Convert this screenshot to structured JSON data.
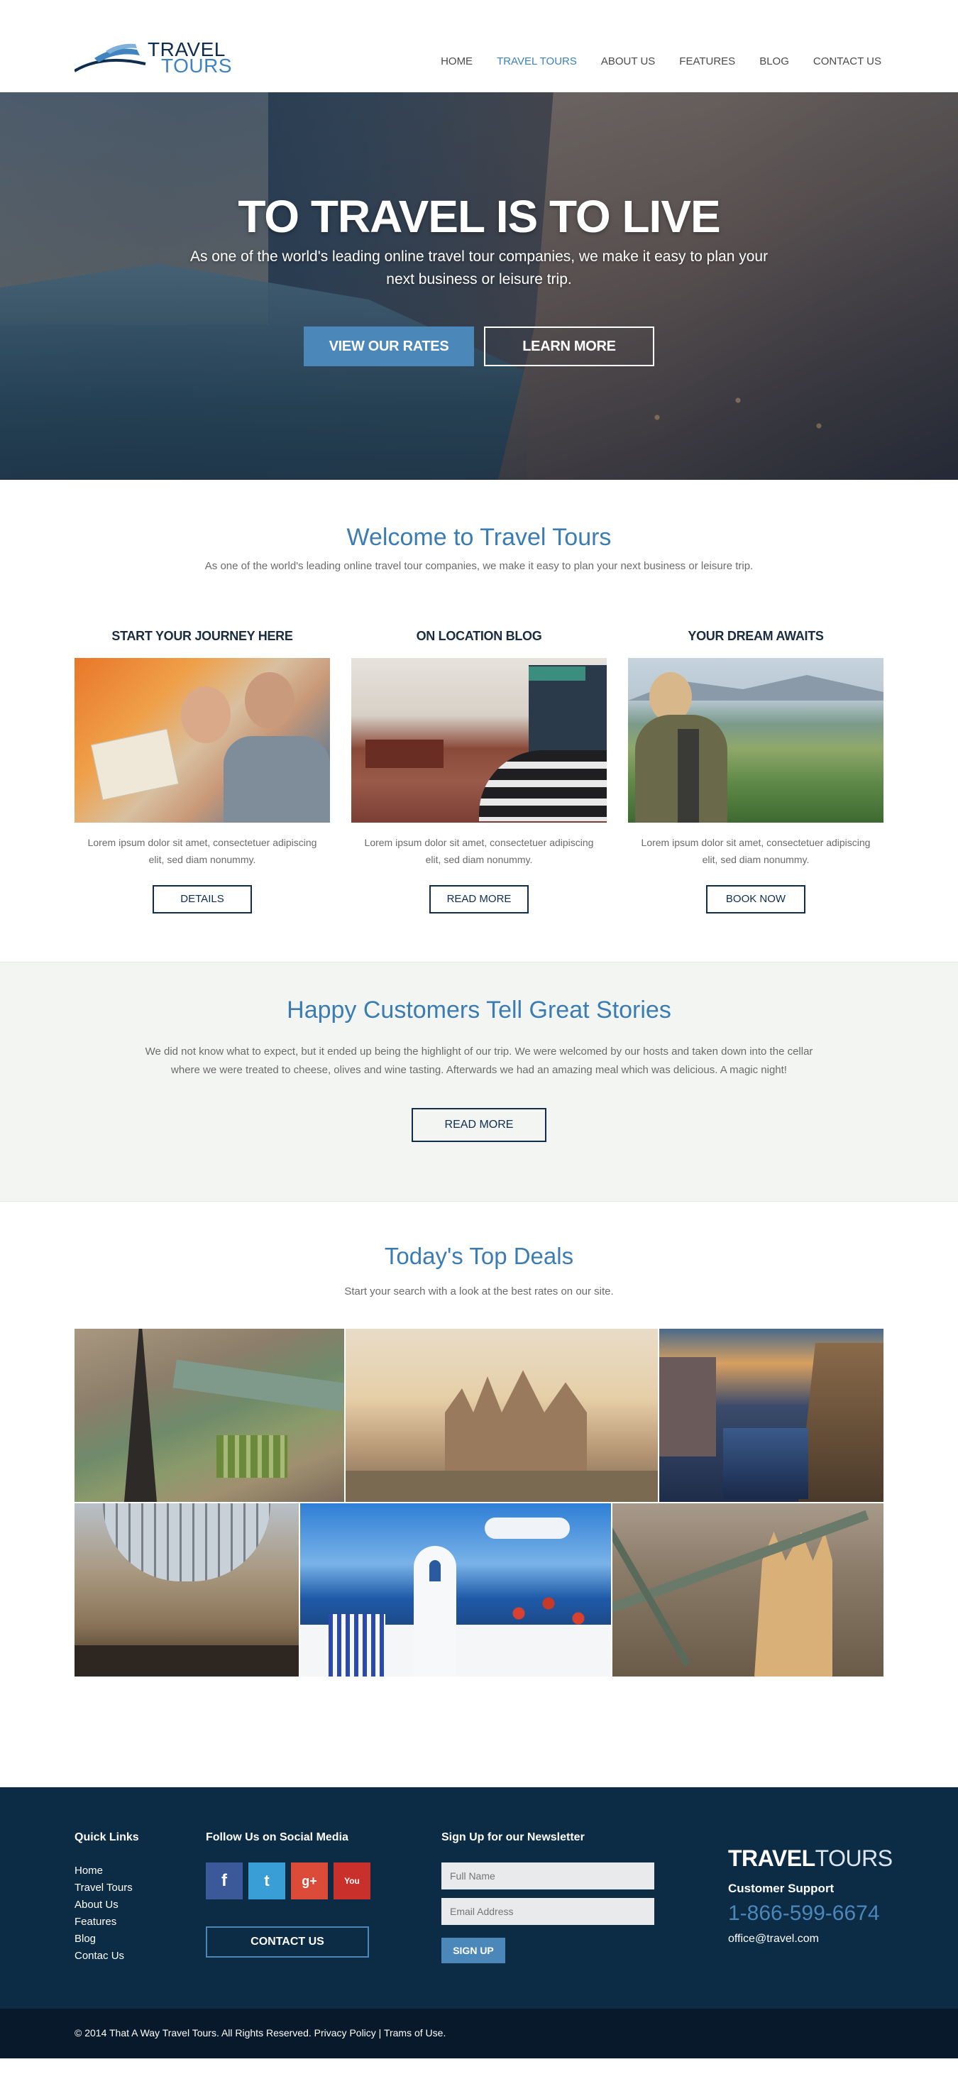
{
  "logo": {
    "line1": "TRAVEL",
    "line2": "TOURS"
  },
  "nav": [
    {
      "label": "HOME",
      "active": false
    },
    {
      "label": "TRAVEL TOURS",
      "active": true
    },
    {
      "label": "ABOUT US",
      "active": false
    },
    {
      "label": "FEATURES",
      "active": false
    },
    {
      "label": "BLOG",
      "active": false
    },
    {
      "label": "CONTACT US",
      "active": false
    }
  ],
  "hero": {
    "title": "TO TRAVEL IS TO LIVE",
    "subtitle": "As one of the world's leading online travel tour companies, we make it easy to plan your next business or leisure trip.",
    "btn_rates": "VIEW OUR RATES",
    "btn_learn": "LEARN MORE"
  },
  "welcome": {
    "title": "Welcome to Travel Tours",
    "subtitle": "As one of the world's leading online travel tour companies, we make it easy to plan your next business or leisure trip.",
    "columns": [
      {
        "title": "START YOUR JOURNEY HERE",
        "text": "Lorem ipsum dolor sit amet, consectetuer adipiscing elit, sed diam nonummy.",
        "button": "DETAILS"
      },
      {
        "title": "ON LOCATION BLOG",
        "text": "Lorem ipsum dolor sit amet, consectetuer adipiscing elit, sed diam nonummy.",
        "button": "READ MORE"
      },
      {
        "title": "YOUR DREAM AWAITS",
        "text": "Lorem ipsum dolor sit amet, consectetuer adipiscing elit, sed diam nonummy.",
        "button": "BOOK NOW"
      }
    ]
  },
  "testimonial": {
    "title": "Happy Customers Tell Great Stories",
    "text": "We did not know what to expect, but it ended up being the highlight of our trip. We were welcomed by our hosts and taken down into the cellar where we were treated to cheese, olives and wine tasting. Afterwards we had an amazing meal which was delicious. A magic night!",
    "button": "READ MORE"
  },
  "deals": {
    "title": "Today's Top Deals",
    "subtitle": "Start your search with a look at the best rates on our site."
  },
  "footer": {
    "quick_links_title": "Quick Links",
    "quick_links": [
      "Home",
      "Travel Tours",
      "About Us",
      "Features",
      "Blog",
      "Contac Us"
    ],
    "social_title": "Follow Us on Social Media",
    "social": [
      {
        "icon": "facebook-icon",
        "glyph": "f",
        "color": "#3b5998"
      },
      {
        "icon": "twitter-icon",
        "glyph": "t",
        "color": "#3a9ed6"
      },
      {
        "icon": "google-plus-icon",
        "glyph": "g+",
        "color": "#dc4a38"
      },
      {
        "icon": "youtube-icon",
        "glyph": "You",
        "color": "#c9302c"
      }
    ],
    "contact_button": "CONTACT US",
    "newsletter_title": "Sign Up for our Newsletter",
    "name_placeholder": "Full Name",
    "email_placeholder": "Email Address",
    "signup_button": "SIGN UP",
    "brand_bold": "TRAVEL",
    "brand_light": "TOURS",
    "support_label": "Customer Support",
    "phone": "1-866-599-6674",
    "email": "office@travel.com",
    "copyright": "© 2014 That A Way Travel Tours. All Rights Reserved. Privacy Policy  |  Trams of Use."
  },
  "colors": {
    "accent": "#4b87b9",
    "navy": "#0c2b45",
    "heading_blue": "#3b7db3"
  }
}
